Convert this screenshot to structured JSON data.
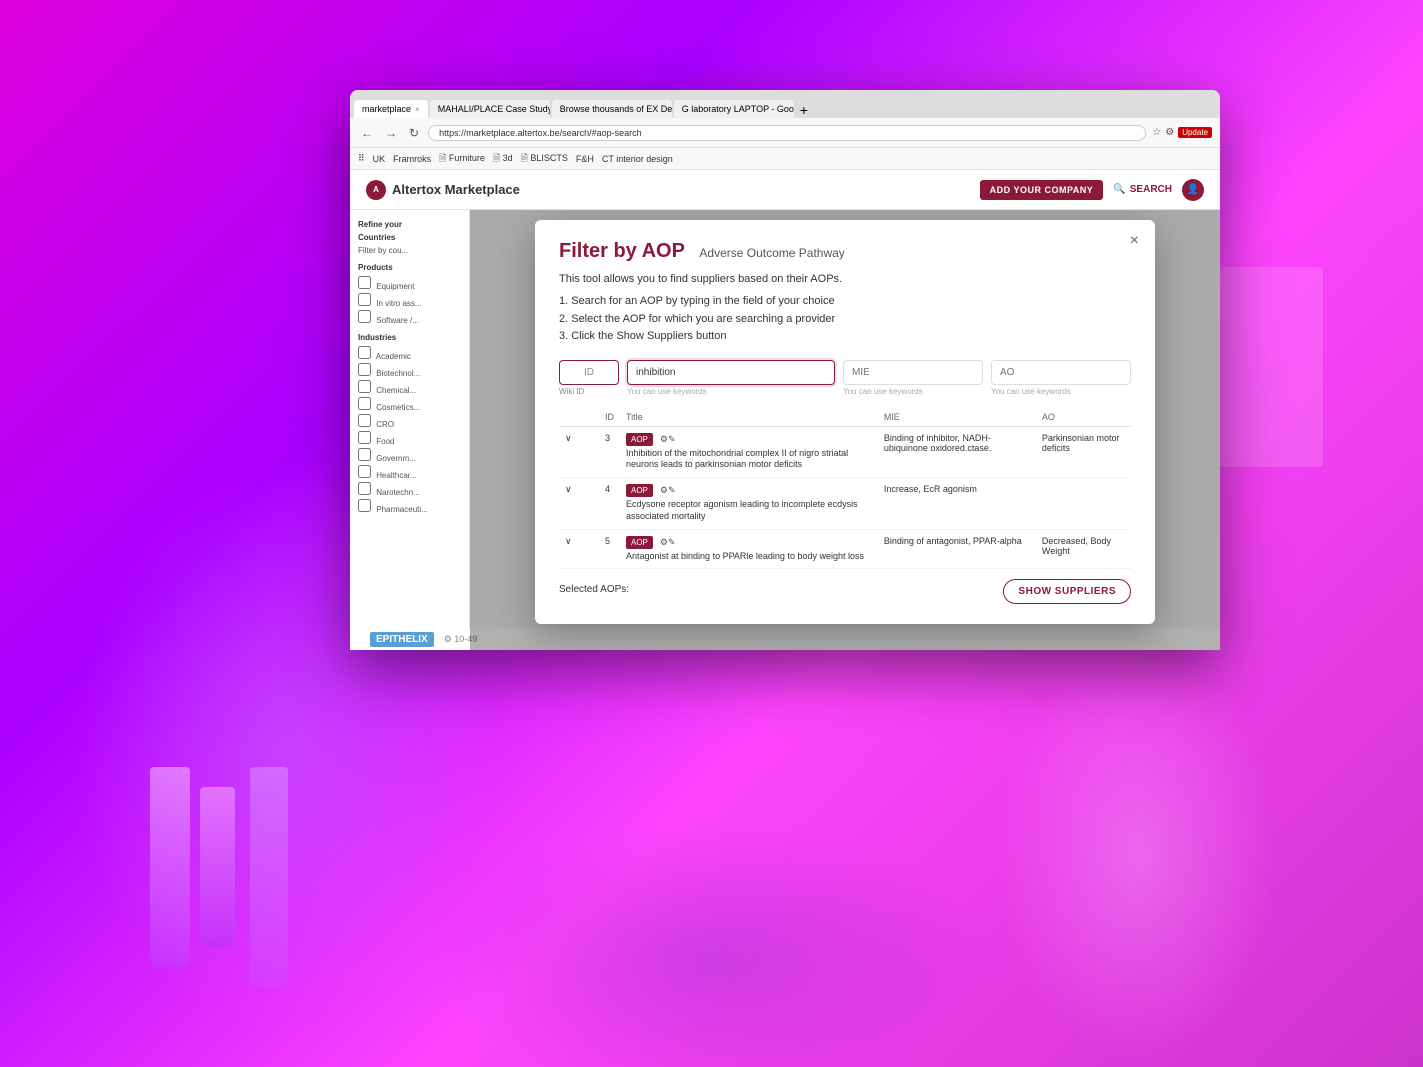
{
  "background": {
    "gradient_start": "#dd00dd",
    "gradient_end": "#aa00ff"
  },
  "browser": {
    "tabs": [
      {
        "label": "marketplace",
        "active": true,
        "closeable": true
      },
      {
        "label": "MAHALI/PLACE Case Study –",
        "active": false,
        "closeable": true
      },
      {
        "label": "Browse thousands of EX Desc...",
        "active": false,
        "closeable": true
      },
      {
        "label": "G laboratory LAPTOP - Google S...",
        "active": false,
        "closeable": true
      }
    ],
    "address": "https://marketplace.altertox.be/search/#aop-search",
    "bookmarks": [
      "UK",
      "Framroks",
      "Furniture",
      "3d",
      "BLISCTS",
      "F&H",
      "CT interior design"
    ]
  },
  "site": {
    "header": {
      "logo": "Altertox Marketplace",
      "add_company_label": "ADD YOUR COMPANY",
      "search_label": "SEARCH"
    },
    "sidebar": {
      "refine_label": "Refine your",
      "sections": [
        {
          "title": "Countries",
          "filter_label": "Filter by cou..."
        },
        {
          "title": "Products",
          "items": [
            "Equipment",
            "In vitro ass...",
            "Software /...",
            ""
          ]
        },
        {
          "title": "Industries",
          "items": [
            "Academic",
            "Biotechnol...",
            "Chemical...",
            "Cosmetics...",
            "CRO",
            "Food",
            "Governm...",
            "Healthcar...",
            "Narotechn...",
            "Pharmaceuti..."
          ]
        }
      ]
    }
  },
  "modal": {
    "title": "Filter by AOP",
    "subtitle": "Adverse Outcome Pathway",
    "description": "This tool allows you to find suppliers based on their AOPs.",
    "instructions": [
      "1. Search for an AOP by typing in the field of your choice",
      "2. Select the AOP for which you are searching a provider",
      "3. Click the Show Suppliers button"
    ],
    "fields": {
      "id": {
        "label": "ID",
        "placeholder": "",
        "hint": "Wiki ID"
      },
      "main": {
        "label": "",
        "value": "inhibition",
        "hint": "You can use keywords"
      },
      "mie": {
        "label": "MIE",
        "placeholder": "",
        "hint": "You can use keywords"
      },
      "ao": {
        "label": "AO",
        "placeholder": "",
        "hint": "You can use keywords"
      }
    },
    "table": {
      "columns": [
        "ID",
        "Title",
        "MIE",
        "AO"
      ],
      "rows": [
        {
          "id": "3",
          "expanded": true,
          "badge": "AOP",
          "title": "Inhibition of the mitochondrial complex II of nigro striatal neurons leads to parkinsonian motor deficits",
          "mie": "Binding of inhibitor, NADH-ubiquinone oxidored.ctase.",
          "ao": "Parkinsonian motor deficits"
        },
        {
          "id": "4",
          "expanded": true,
          "badge": "AOP",
          "title": "Ecdysone receptor agonism leading to incomplete ecdysis associated mortality",
          "mie": "Increase, EcR agonism",
          "ao": ""
        },
        {
          "id": "5",
          "expanded": true,
          "badge": "AOP",
          "title": "Antagonist at binding to PPARle leading to body weight loss",
          "mie": "Binding of antagonist, PPAR-alpha",
          "ao": "Decreased, Body Weight"
        }
      ]
    },
    "selected_aops_label": "Selected AOPs:",
    "show_suppliers_label": "SHOW SUPPLIERS",
    "close_label": "×"
  },
  "footer": {
    "logo": "EPITHELIX"
  }
}
